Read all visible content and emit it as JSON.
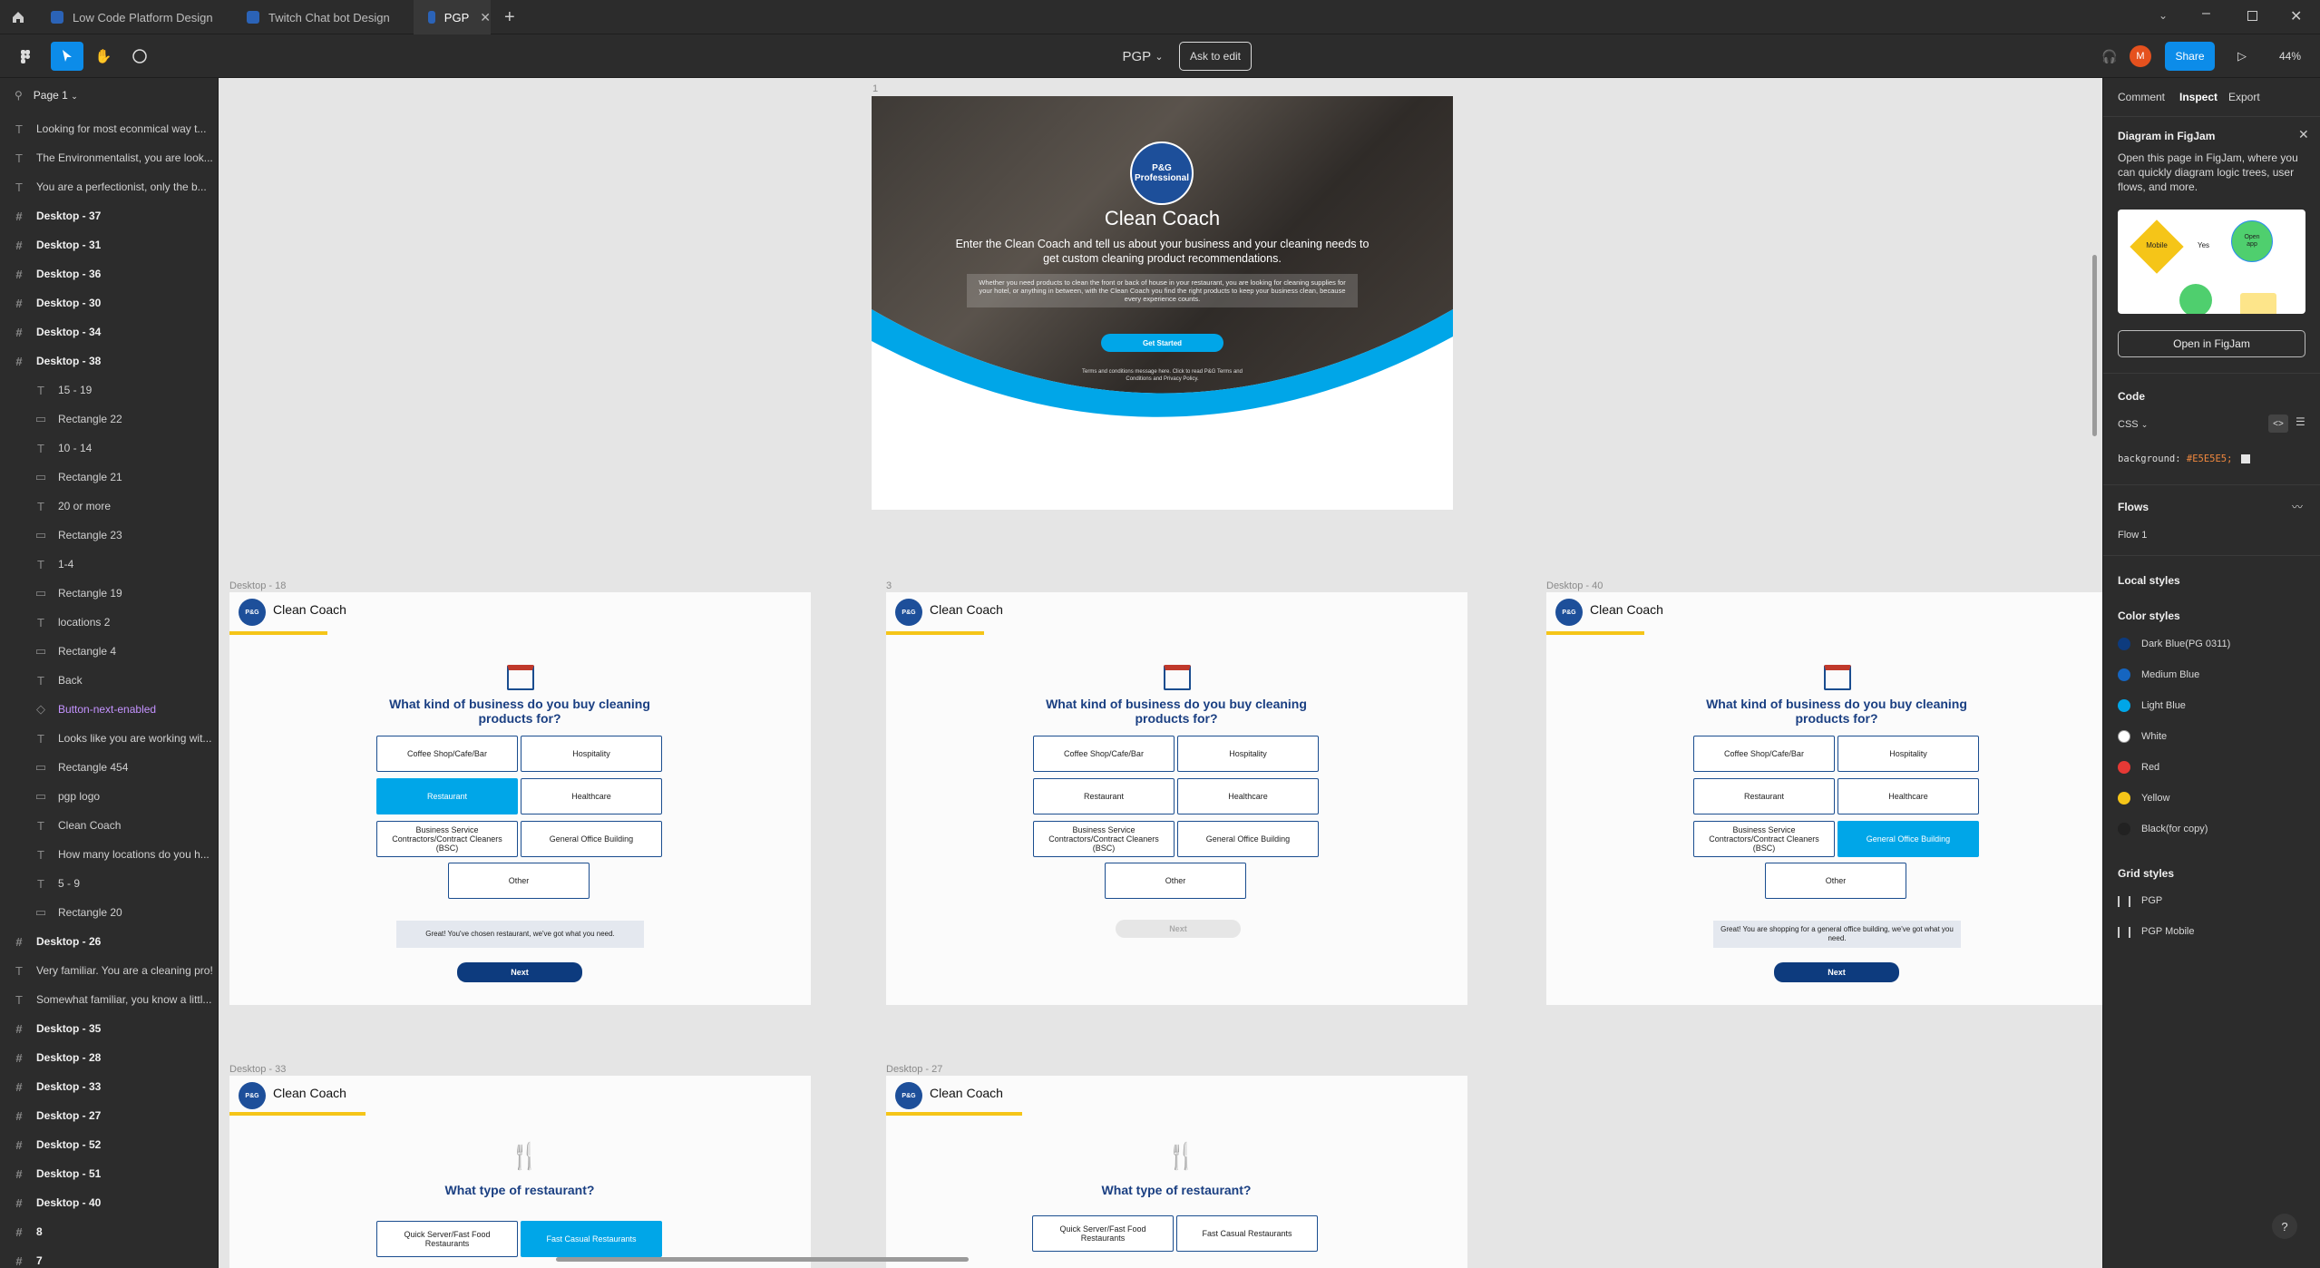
{
  "tabs": [
    {
      "label": "Low Code Platform Design"
    },
    {
      "label": "Twitch Chat bot Design"
    },
    {
      "label": "PGP"
    }
  ],
  "toolbar": {
    "file_name": "PGP",
    "ask_to_edit": "Ask to edit",
    "avatar_initial": "M",
    "share": "Share",
    "zoom": "44%"
  },
  "sidebar": {
    "page": "Page 1",
    "layers": [
      {
        "label": "Looking for most econmical way t...",
        "kind": "text"
      },
      {
        "label": "The Environmentalist, you are look...",
        "kind": "text"
      },
      {
        "label": "You are a perfectionist, only the b...",
        "kind": "text"
      },
      {
        "label": "Desktop - 37",
        "kind": "frame"
      },
      {
        "label": "Desktop - 31",
        "kind": "frame"
      },
      {
        "label": "Desktop - 36",
        "kind": "frame"
      },
      {
        "label": "Desktop - 30",
        "kind": "frame"
      },
      {
        "label": "Desktop - 34",
        "kind": "frame"
      },
      {
        "label": "Desktop - 38",
        "kind": "frame"
      },
      {
        "label": "15 - 19",
        "kind": "text"
      },
      {
        "label": "Rectangle 22",
        "kind": "rect"
      },
      {
        "label": "10 - 14",
        "kind": "text"
      },
      {
        "label": "Rectangle 21",
        "kind": "rect"
      },
      {
        "label": "20 or more",
        "kind": "text"
      },
      {
        "label": "Rectangle 23",
        "kind": "rect"
      },
      {
        "label": "1-4",
        "kind": "text"
      },
      {
        "label": "Rectangle 19",
        "kind": "rect"
      },
      {
        "label": "locations 2",
        "kind": "text"
      },
      {
        "label": "Rectangle 4",
        "kind": "rect"
      },
      {
        "label": "Back",
        "kind": "text"
      },
      {
        "label": "Button-next-enabled",
        "kind": "comp"
      },
      {
        "label": "Looks like you are working wit...",
        "kind": "text"
      },
      {
        "label": "Rectangle 454",
        "kind": "rect"
      },
      {
        "label": "pgp logo",
        "kind": "rect"
      },
      {
        "label": "Clean Coach",
        "kind": "text"
      },
      {
        "label": "How many locations do you h...",
        "kind": "text"
      },
      {
        "label": "5 - 9",
        "kind": "text"
      },
      {
        "label": "Rectangle 20",
        "kind": "rect"
      },
      {
        "label": "Desktop - 26",
        "kind": "frame"
      },
      {
        "label": "Very familiar. You are a cleaning pro!",
        "kind": "text"
      },
      {
        "label": "Somewhat familiar, you know a littl...",
        "kind": "text"
      },
      {
        "label": "Desktop - 35",
        "kind": "frame"
      },
      {
        "label": "Desktop - 28",
        "kind": "frame"
      },
      {
        "label": "Desktop - 33",
        "kind": "frame"
      },
      {
        "label": "Desktop - 27",
        "kind": "frame"
      },
      {
        "label": "Desktop - 52",
        "kind": "frame"
      },
      {
        "label": "Desktop - 51",
        "kind": "frame"
      },
      {
        "label": "Desktop - 40",
        "kind": "frame"
      },
      {
        "label": "8",
        "kind": "frame"
      },
      {
        "label": "7",
        "kind": "frame"
      }
    ]
  },
  "hero": {
    "frame_label": "1",
    "brand": "P&G Professional",
    "title": "Clean Coach",
    "subtitle": "Enter the Clean Coach and tell us about your business and your cleaning needs to get custom cleaning product recommendations.",
    "body": "Whether you need products to clean the front or back of house in your restaurant, you are looking for cleaning supplies for your hotel, or anything in between, with the Clean Coach you find the right products to keep your business clean, because every experience counts.",
    "cta": "Get Started",
    "legal": "Terms and conditions message here. Click to read P&G Terms and Conditions and Privacy Policy."
  },
  "business_frames": [
    {
      "label": "Desktop - 18",
      "selected": 2,
      "message": "Great! You've chosen restaurant, we've got what you need.",
      "next_enabled": true
    },
    {
      "label": "3",
      "selected": -1,
      "message": "",
      "next_enabled": false
    },
    {
      "label": "Desktop - 40",
      "selected": 5,
      "message": "Great! You are shopping for a general office building, we've got what you need.",
      "next_enabled": true
    }
  ],
  "business_common": {
    "app_title": "Clean Coach",
    "logo_text": "P&G",
    "question": "What kind of business do you buy cleaning products for?",
    "options": [
      "Coffee Shop/Cafe/Bar",
      "Hospitality",
      "Restaurant",
      "Healthcare",
      "Business Service Contractors/Contract Cleaners (BSC)",
      "General Office Building",
      "Other"
    ],
    "next": "Next"
  },
  "restaurant_frames": [
    {
      "label": "Desktop - 33",
      "selected": 1
    },
    {
      "label": "Desktop - 27",
      "selected": -1
    }
  ],
  "restaurant_common": {
    "question": "What type of restaurant?",
    "options": [
      "Quick Server/Fast Food Restaurants",
      "Fast Casual Restaurants"
    ]
  },
  "right_panel": {
    "tabs": [
      "Comment",
      "Inspect",
      "Export"
    ],
    "figjam_title": "Diagram in FigJam",
    "figjam_desc": "Open this page in FigJam, where you can quickly diagram logic trees, user flows, and more.",
    "figjam_preview_mobile": "Mobile",
    "figjam_preview_yes": "Yes",
    "figjam_preview_open": "Open app",
    "open_figjam": "Open in FigJam",
    "code_title": "Code",
    "code_lang": "CSS",
    "code_prop": "background:",
    "code_value": "#E5E5E5;",
    "flows_title": "Flows",
    "flow1": "Flow 1",
    "local_styles": "Local styles",
    "color_styles": "Color styles",
    "colors": [
      {
        "name": "Dark Blue(PG 0311)",
        "hex": "#0d3b7e"
      },
      {
        "name": "Medium Blue",
        "hex": "#1565c0"
      },
      {
        "name": "Light Blue",
        "hex": "#00a6e8"
      },
      {
        "name": "White",
        "hex": "#ffffff"
      },
      {
        "name": "Red",
        "hex": "#e53935"
      },
      {
        "name": "Yellow",
        "hex": "#f5c518"
      },
      {
        "name": "Black(for copy)",
        "hex": "#222222"
      }
    ],
    "grid_styles": "Grid styles",
    "grids": [
      "PGP",
      "PGP Mobile"
    ]
  }
}
